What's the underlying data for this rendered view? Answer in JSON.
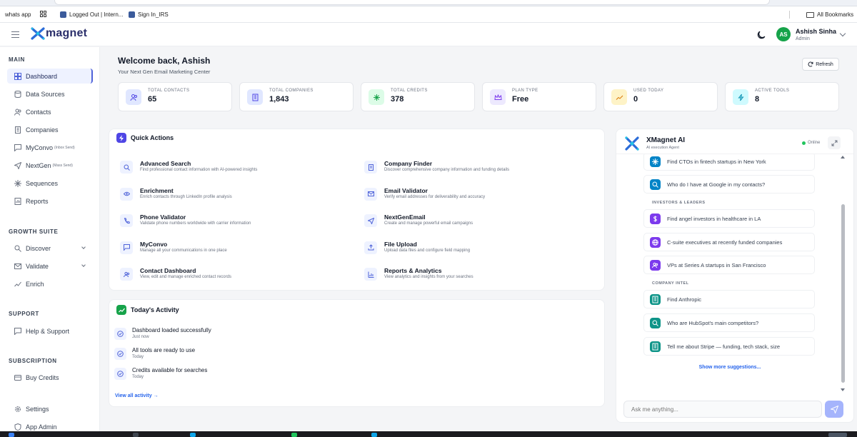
{
  "bookmarks": [
    {
      "label": "whats app"
    },
    {
      "label": ""
    },
    {
      "label": "Logged Out | Intern..."
    },
    {
      "label": "Sign In_IRS"
    }
  ],
  "all_bookmarks": "All Bookmarks",
  "header": {
    "logo_text": "magnet",
    "user_initials": "AS",
    "user_name": "Ashish Sinha",
    "user_role": "Admin"
  },
  "sidebar": {
    "main_label": "MAIN",
    "growth_label": "GROWTH SUITE",
    "support_label": "SUPPORT",
    "subscription_label": "SUBSCRIPTION",
    "items": {
      "dashboard": "Dashboard",
      "data_sources": "Data Sources",
      "contacts": "Contacts",
      "companies": "Companies",
      "myconvo": "MyConvo",
      "myconvo_sub": "(Inbox Send)",
      "nextgen": "NextGen",
      "nextgen_sub": "(Mass Send)",
      "sequences": "Sequences",
      "reports": "Reports",
      "discover": "Discover",
      "validate": "Validate",
      "enrich": "Enrich",
      "help": "Help & Support",
      "buy_credits": "Buy Credits",
      "settings": "Settings",
      "app_admin": "App Admin"
    }
  },
  "main": {
    "welcome": "Welcome back, Ashish",
    "subtitle": "Your Next Gen Email Marketing Center",
    "refresh": "Refresh",
    "stats": [
      {
        "label": "TOTAL CONTACTS",
        "value": "65",
        "color": "#e0e7ff",
        "fg": "#4f46e5"
      },
      {
        "label": "TOTAL COMPANIES",
        "value": "1,843",
        "color": "#e0e7ff",
        "fg": "#4f46e5"
      },
      {
        "label": "TOTAL CREDITS",
        "value": "378",
        "color": "#dcfce7",
        "fg": "#16a34a"
      },
      {
        "label": "PLAN TYPE",
        "value": "Free",
        "color": "#ede9fe",
        "fg": "#7c3aed"
      },
      {
        "label": "USED TODAY",
        "value": "0",
        "color": "#fef3c7",
        "fg": "#d97706"
      },
      {
        "label": "ACTIVE TOOLS",
        "value": "8",
        "color": "#cffafe",
        "fg": "#0891b2"
      }
    ]
  },
  "quick_actions": {
    "title": "Quick Actions",
    "items": [
      {
        "title": "Advanced Search",
        "desc": "Find professional contact information with AI-powered insights"
      },
      {
        "title": "Company Finder",
        "desc": "Discover comprehensive company information and funding details"
      },
      {
        "title": "Enrichment",
        "desc": "Enrich contacts through LinkedIn profile analysis"
      },
      {
        "title": "Email Validator",
        "desc": "Verify email addresses for deliverability and accuracy"
      },
      {
        "title": "Phone Validator",
        "desc": "Validate phone numbers worldwide with carrier information"
      },
      {
        "title": "NextGenEmail",
        "desc": "Create and manage powerful email campaigns"
      },
      {
        "title": "MyConvo",
        "desc": "Manage all your communications in one place"
      },
      {
        "title": "File Upload",
        "desc": "Upload data files and configure field mapping"
      },
      {
        "title": "Contact Dashboard",
        "desc": "View, edit and manage enriched contact records"
      },
      {
        "title": "Reports & Analytics",
        "desc": "View analytics and insights from your searches"
      }
    ]
  },
  "activity": {
    "title": "Today's Activity",
    "items": [
      {
        "title": "Dashboard loaded successfully",
        "time": "Just now"
      },
      {
        "title": "All tools are ready to use",
        "time": "Today"
      },
      {
        "title": "Credits available for searches",
        "time": "Today"
      }
    ],
    "view_all": "View all activity →"
  },
  "ai": {
    "title": "XMagnet AI",
    "subtitle": "AI execution Agent",
    "status": "Online",
    "suggestions_top": [
      {
        "text": "Find CTOs in fintech startups in New York",
        "color": "#e0f2fe",
        "fg": "#0284c7"
      },
      {
        "text": "Who do I have at Google in my contacts?",
        "color": "#e0f2fe",
        "fg": "#0284c7"
      }
    ],
    "group_investors": "INVESTORS & LEADERS",
    "suggestions_investors": [
      {
        "text": "Find angel investors in healthcare in LA",
        "color": "#ede9fe",
        "fg": "#7c3aed"
      },
      {
        "text": "C-suite executives at recently funded companies",
        "color": "#ede9fe",
        "fg": "#7c3aed"
      },
      {
        "text": "VPs at Series A startups in San Francisco",
        "color": "#ede9fe",
        "fg": "#7c3aed"
      }
    ],
    "group_company": "COMPANY INTEL",
    "suggestions_company": [
      {
        "text": "Find Anthropic",
        "color": "#ccfbf1",
        "fg": "#0d9488"
      },
      {
        "text": "Who are HubSpot's main competitors?",
        "color": "#ccfbf1",
        "fg": "#0d9488"
      },
      {
        "text": "Tell me about Stripe — funding, tech stack, size",
        "color": "#ccfbf1",
        "fg": "#0d9488"
      }
    ],
    "show_more": "Show more suggestions...",
    "placeholder": "Ask me anything..."
  },
  "colors": {
    "accent": "#4f63d9",
    "brand_navy": "#2b2f6b",
    "online": "#22c55e",
    "link": "#2563eb"
  }
}
